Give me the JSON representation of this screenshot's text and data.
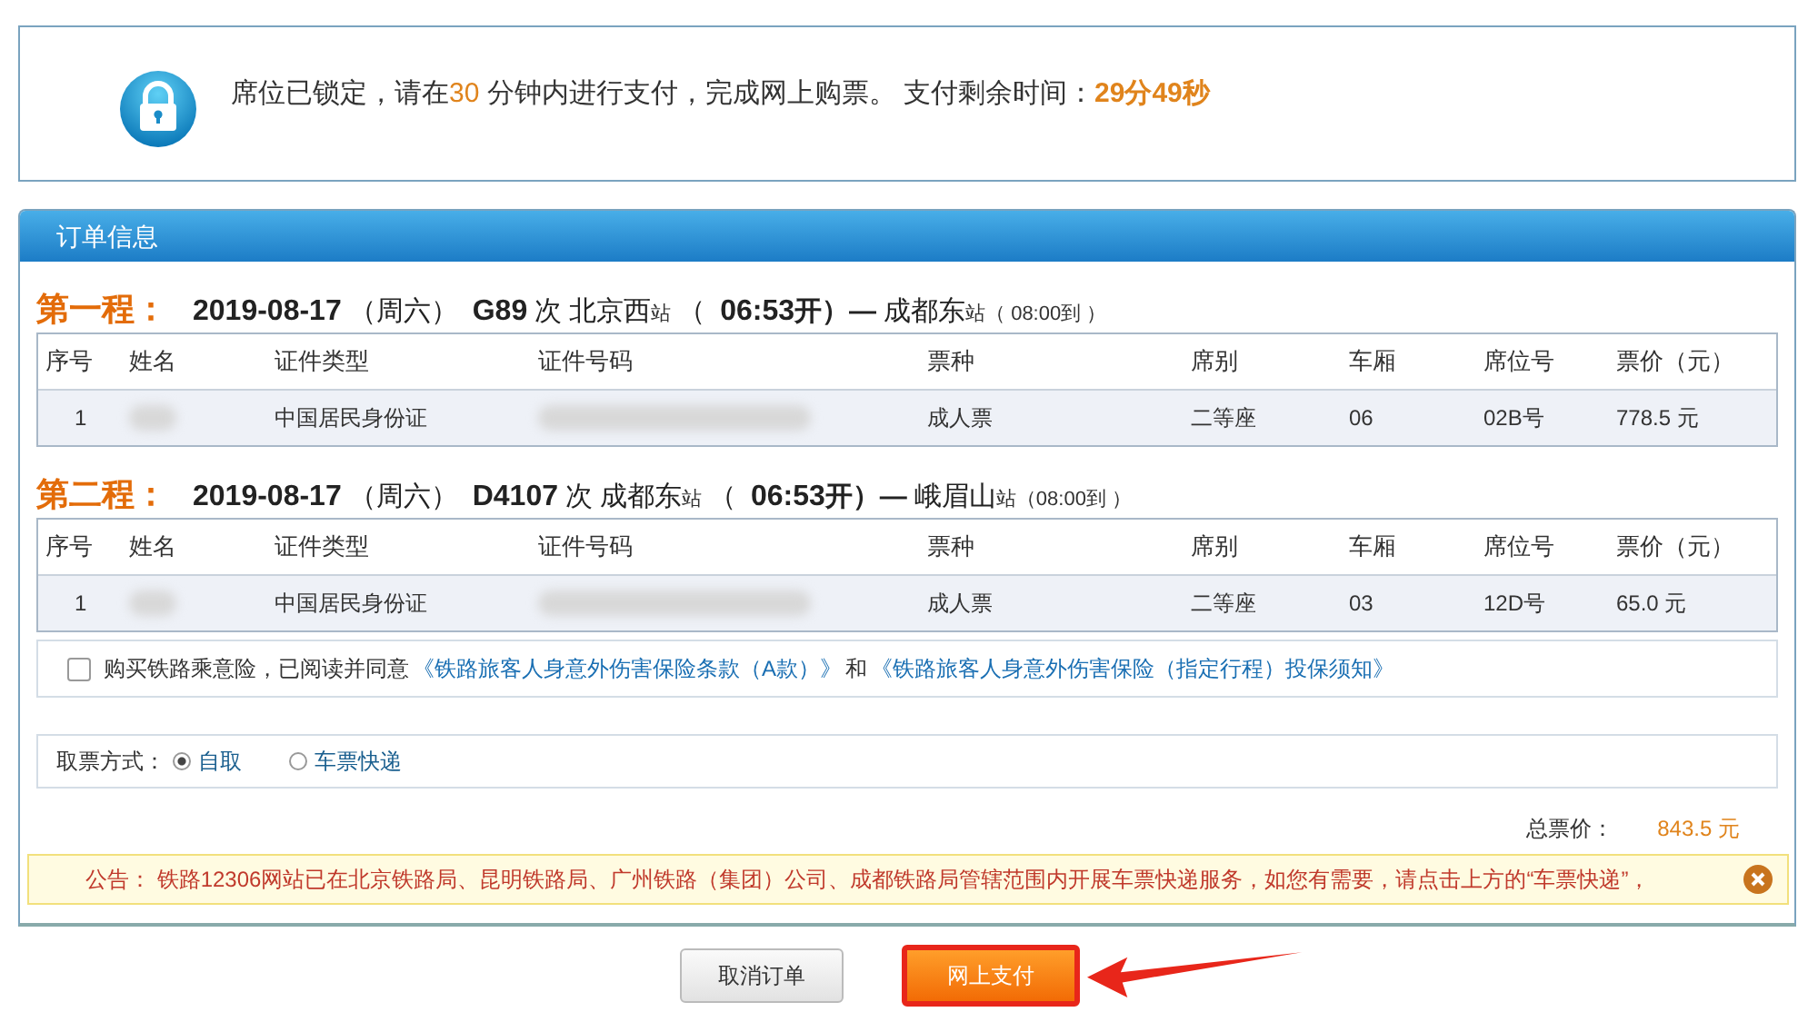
{
  "lock_notice": {
    "segments": [
      {
        "text": "席位已锁定，请在",
        "kind": "plain"
      },
      {
        "text": "30",
        "kind": "accent"
      },
      {
        "text": " 分钟内进行支付，完成网上购票。 支付剩余时间：",
        "kind": "plain"
      },
      {
        "text": "29分49秒",
        "kind": "timer"
      }
    ]
  },
  "order": {
    "title": "订单信息",
    "trips": [
      {
        "label": "第一程：",
        "segments": [
          {
            "text": "2019-08-17",
            "kind": "big"
          },
          {
            "text": "（周六）",
            "kind": "mid"
          },
          {
            "text": "G89",
            "kind": "big"
          },
          {
            "text": "次",
            "kind": "mid"
          },
          {
            "text": "北京西",
            "kind": "mid"
          },
          {
            "text": "站",
            "kind": "small"
          },
          {
            "text": "（",
            "kind": "mid"
          },
          {
            "text": "06:53",
            "kind": "big"
          },
          {
            "text": "开）—",
            "kind": "midb"
          },
          {
            "text": "成都东",
            "kind": "mid"
          },
          {
            "text": "站",
            "kind": "small"
          },
          {
            "text": "（ 08:00到 ）",
            "kind": "small"
          }
        ],
        "columns": [
          "序号",
          "姓名",
          "证件类型",
          "证件号码",
          "票种",
          "席别",
          "车厢",
          "席位号",
          "票价（元）"
        ],
        "rows": [
          {
            "index": "1",
            "id_type": "中国居民身份证",
            "ticket_type": "成人票",
            "seat_class": "二等座",
            "car": "06",
            "seat": "02B号",
            "price": "778.5 元"
          }
        ]
      },
      {
        "label": "第二程：",
        "segments": [
          {
            "text": "2019-08-17",
            "kind": "big"
          },
          {
            "text": "（周六）",
            "kind": "mid"
          },
          {
            "text": "D4107",
            "kind": "big"
          },
          {
            "text": "次",
            "kind": "mid"
          },
          {
            "text": "成都东",
            "kind": "mid"
          },
          {
            "text": "站",
            "kind": "small"
          },
          {
            "text": "（",
            "kind": "mid"
          },
          {
            "text": "06:53",
            "kind": "big"
          },
          {
            "text": "开）—",
            "kind": "midb"
          },
          {
            "text": "峨眉山",
            "kind": "mid"
          },
          {
            "text": "站",
            "kind": "small"
          },
          {
            "text": "（08:00到 ）",
            "kind": "small"
          }
        ],
        "columns": [
          "序号",
          "姓名",
          "证件类型",
          "证件号码",
          "票种",
          "席别",
          "车厢",
          "席位号",
          "票价（元）"
        ],
        "rows": [
          {
            "index": "1",
            "id_type": "中国居民身份证",
            "ticket_type": "成人票",
            "seat_class": "二等座",
            "car": "03",
            "seat": "12D号",
            "price": "65.0 元"
          }
        ]
      }
    ],
    "insurance": {
      "checked": false,
      "text": "购买铁路乘意险，已阅读并同意",
      "link_1": "《铁路旅客人身意外伤害保险条款（A款）》",
      "joiner": "和",
      "link_2": "《铁路旅客人身意外伤害保险（指定行程）投保须知》"
    },
    "pickup": {
      "label": "取票方式：",
      "options": [
        {
          "label": "自取",
          "selected": true
        },
        {
          "label": "车票快递",
          "selected": false
        }
      ]
    },
    "total": {
      "label": "总票价：",
      "value": "843.5 元"
    },
    "announcement": {
      "text": "公告： 铁路12306网站已在北京铁路局、昆明铁路局、广州铁路（集团）公司、成都铁路局管辖范围内开展车票快递服务，如您有需要，请点击上方的“车票快递”，"
    },
    "buttons": [
      {
        "label": "取消订单",
        "kind": "secondary"
      },
      {
        "label": "网上支付",
        "kind": "primary"
      }
    ]
  }
}
